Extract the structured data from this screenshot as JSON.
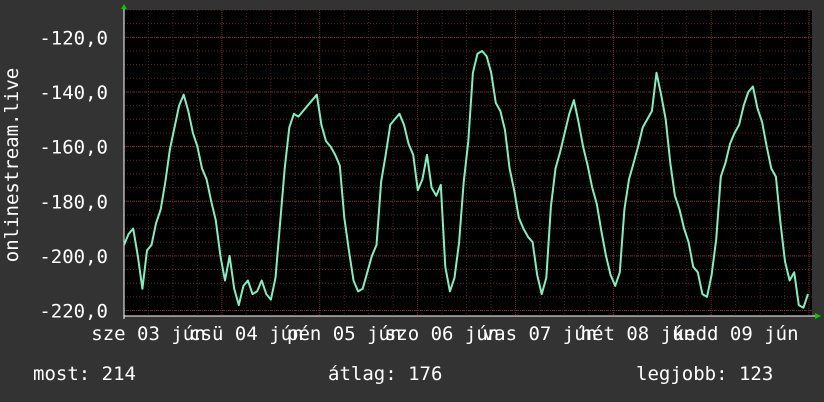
{
  "chart_data": {
    "type": "line",
    "ylabel": "onlinestream.live",
    "ylim": [
      -222,
      -110
    ],
    "yticks": [
      -120,
      -140,
      -160,
      -180,
      -200,
      -220
    ],
    "ytick_labels": [
      "-120,0",
      "-140,0",
      "-160,0",
      "-180,0",
      "-200,0",
      "-220,0"
    ],
    "xtick_labels": [
      "sze 03 jún",
      "csü 04 jún",
      "pén 05 jún",
      "szo 06 jún",
      "vas 07 jún",
      "hét 08 jún",
      "kedd 09 jún"
    ],
    "series": [
      {
        "values": [
          -196,
          -192,
          -190,
          -200,
          -212,
          -198,
          -196,
          -188,
          -183,
          -173,
          -161,
          -153,
          -145,
          -141,
          -147,
          -155,
          -160,
          -168,
          -172,
          -180,
          -187,
          -200,
          -209,
          -200,
          -212,
          -218,
          -211,
          -209,
          -214,
          -213,
          -209,
          -214,
          -216,
          -208,
          -188,
          -168,
          -153,
          -148,
          -149,
          -147,
          -145,
          -143,
          -141,
          -152,
          -158,
          -160,
          -163,
          -167,
          -186,
          -198,
          -209,
          -213,
          -212,
          -206,
          -200,
          -196,
          -173,
          -163,
          -152,
          -150,
          -148,
          -152,
          -159,
          -163,
          -176,
          -172,
          -163,
          -175,
          -178,
          -174,
          -204,
          -213,
          -208,
          -195,
          -173,
          -158,
          -133,
          -126,
          -125,
          -127,
          -133,
          -144,
          -147,
          -154,
          -168,
          -176,
          -186,
          -190,
          -193,
          -195,
          -207,
          -214,
          -208,
          -182,
          -168,
          -162,
          -155,
          -148,
          -143,
          -151,
          -160,
          -167,
          -175,
          -181,
          -191,
          -200,
          -207,
          -211,
          -206,
          -183,
          -172,
          -166,
          -160,
          -153,
          -150,
          -147,
          -133,
          -141,
          -150,
          -166,
          -178,
          -183,
          -190,
          -195,
          -204,
          -206,
          -214,
          -215,
          -207,
          -194,
          -171,
          -166,
          -159,
          -155,
          -152,
          -145,
          -140,
          -138,
          -146,
          -151,
          -160,
          -168,
          -171,
          -188,
          -202,
          -209,
          -206,
          -218,
          -219,
          -214
        ]
      }
    ]
  },
  "footer": {
    "current": "most: 214",
    "average": "átlag: 176",
    "best": "legjobb: 123"
  }
}
